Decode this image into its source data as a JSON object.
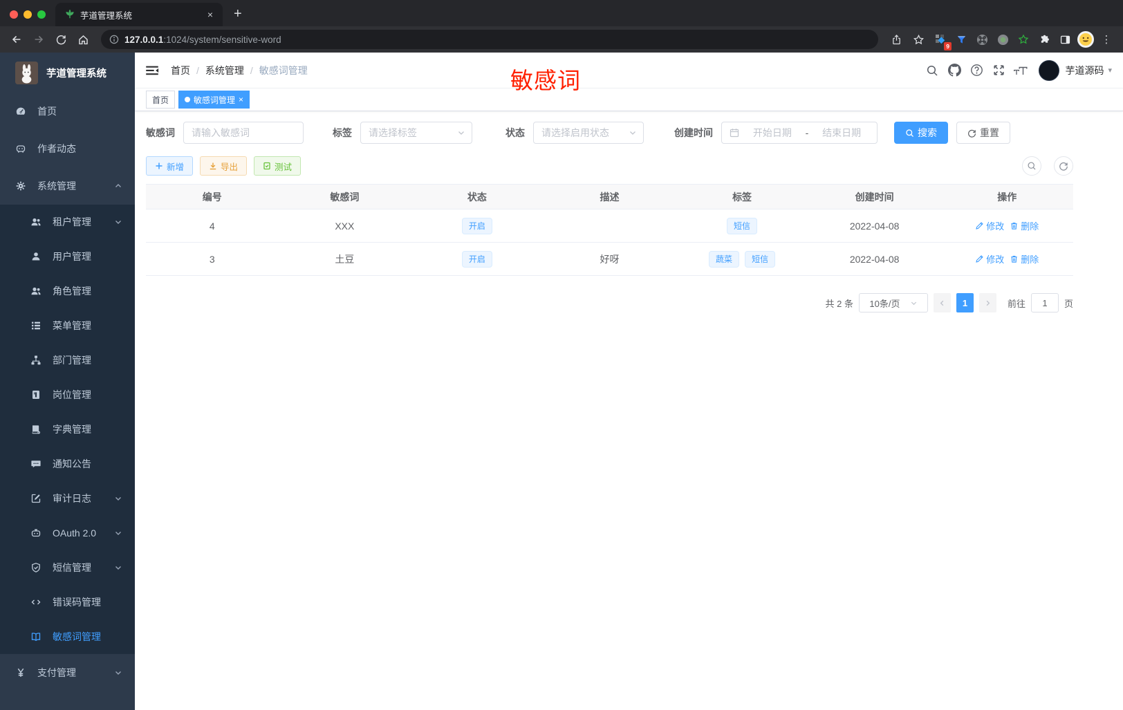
{
  "browser": {
    "tab_title": "芋道管理系统",
    "url_host": "127.0.0.1",
    "url_rest": ":1024/system/sensitive-word",
    "ext_badge": "9"
  },
  "icons": {
    "close": "×",
    "plus": "+",
    "caret": "▾",
    "sep": "/",
    "date_sep": "-",
    "kebab": "⋮"
  },
  "annotation": {
    "text": "敏感词"
  },
  "sidebar": {
    "title": "芋道管理系统",
    "items": [
      {
        "label": "首页",
        "icon": "gauge-icon"
      },
      {
        "label": "作者动态",
        "icon": "author-chat-icon"
      },
      {
        "label": "系统管理",
        "icon": "gear-icon"
      },
      {
        "label": "租户管理",
        "icon": "tenant-users-icon"
      },
      {
        "label": "用户管理",
        "icon": "user-icon"
      },
      {
        "label": "角色管理",
        "icon": "roles-users-icon"
      },
      {
        "label": "菜单管理",
        "icon": "menu-tree-icon"
      },
      {
        "label": "部门管理",
        "icon": "org-chart-icon"
      },
      {
        "label": "岗位管理",
        "icon": "post-badge-icon"
      },
      {
        "label": "字典管理",
        "icon": "dict-book-icon"
      },
      {
        "label": "通知公告",
        "icon": "notice-chat-icon"
      },
      {
        "label": "审计日志",
        "icon": "audit-edit-icon"
      },
      {
        "label": "OAuth 2.0",
        "icon": "robot-icon"
      },
      {
        "label": "短信管理",
        "icon": "shield-check-icon"
      },
      {
        "label": "错误码管理",
        "icon": "code-icon"
      },
      {
        "label": "敏感词管理",
        "icon": "open-book-icon"
      },
      {
        "label": "支付管理",
        "icon": "yen-icon"
      }
    ]
  },
  "navbar": {
    "breadcrumb": [
      "首页",
      "系统管理",
      "敏感词管理"
    ],
    "username": "芋道源码"
  },
  "tabs": [
    {
      "label": "首页"
    },
    {
      "label": "敏感词管理",
      "active": true
    }
  ],
  "filters": {
    "keyword_label": "敏感词",
    "keyword_placeholder": "请输入敏感词",
    "tag_label": "标签",
    "tag_placeholder": "请选择标签",
    "status_label": "状态",
    "status_placeholder": "请选择启用状态",
    "date_label": "创建时间",
    "date_start_placeholder": "开始日期",
    "date_end_placeholder": "结束日期",
    "search_label": "搜索",
    "reset_label": "重置"
  },
  "actions": {
    "add_label": "新增",
    "export_label": "导出",
    "test_label": "测试"
  },
  "table": {
    "headers": [
      "编号",
      "敏感词",
      "状态",
      "描述",
      "标签",
      "创建时间",
      "操作"
    ],
    "edit_label": "修改",
    "delete_label": "删除",
    "rows": [
      {
        "id": "4",
        "word": "XXX",
        "status": "开启",
        "desc": "",
        "tags": [
          "短信"
        ],
        "time": "2022-04-08"
      },
      {
        "id": "3",
        "word": "土豆",
        "status": "开启",
        "desc": "好呀",
        "tags": [
          "蔬菜",
          "短信"
        ],
        "time": "2022-04-08"
      }
    ]
  },
  "pager": {
    "total": "共 2 条",
    "size": "10条/页",
    "page": "1",
    "goto_label": "前往",
    "goto_value": "1",
    "unit_label": "页"
  },
  "colors": {
    "accent": "#409eff",
    "warning": "#e6a23c",
    "success": "#67c23a",
    "annotation_red": "#ff2000",
    "sidebar_bg": "#2d3a4b",
    "submenu_bg": "#1f2d3d"
  }
}
